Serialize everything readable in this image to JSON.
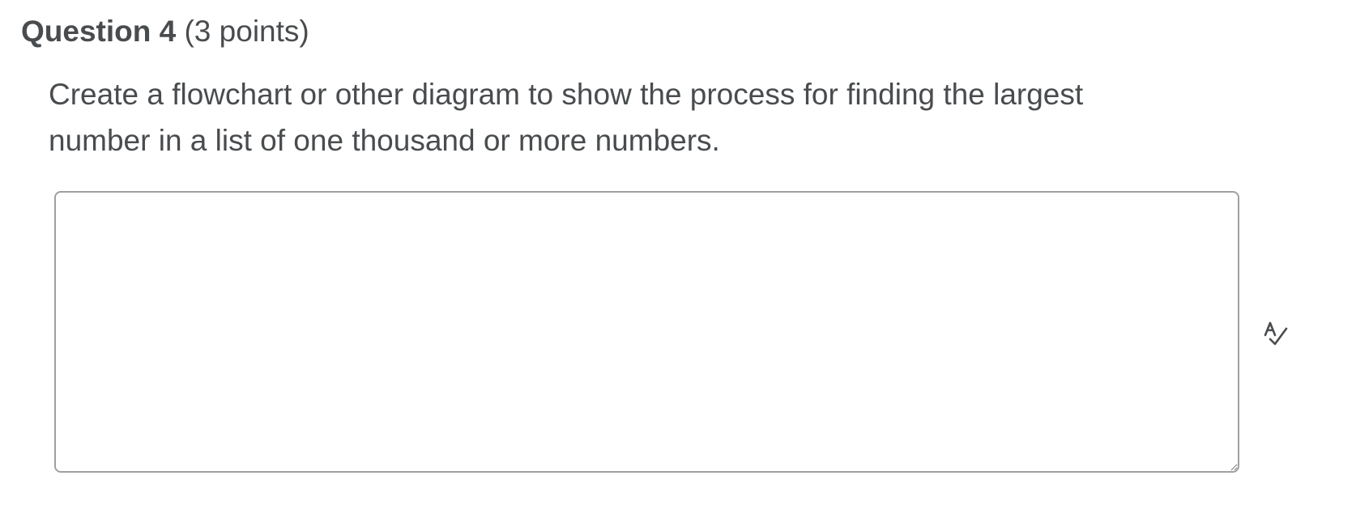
{
  "question": {
    "title": "Question 4",
    "points": "(3 points)",
    "prompt": "Create a flowchart or other diagram to show the process for finding the largest number in a list of one thousand or more numbers."
  },
  "answer": {
    "value": "",
    "placeholder": ""
  },
  "spellcheck": {
    "icon": "spellcheck-icon"
  },
  "colors": {
    "text": "#494c4e",
    "border": "#9ea0a2",
    "background": "#ffffff"
  }
}
